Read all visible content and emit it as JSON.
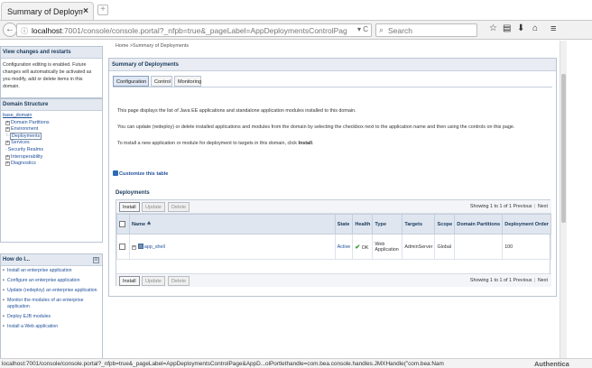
{
  "browser": {
    "tab_title": "Summary of Deploymen...",
    "tab_close": "×",
    "new_tab": "+",
    "url_host": "localhost",
    "url_path": ":7001/console/console.portal?_nfpb=true&_pageLabel=AppDeploymentsControlPage&AppDeploymentsContro",
    "search_placeholder": "Search",
    "nav_icons": [
      "star-icon",
      "bookmarks-icon",
      "download-icon",
      "home-icon",
      "menu-icon"
    ]
  },
  "sidebar": {
    "change_center": {
      "title": "View changes and restarts",
      "body": "Configuration editing is enabled. Future changes will automatically be activated as you modify, add or delete items in this domain."
    },
    "domain_structure": {
      "title": "Domain Structure",
      "root": "base_domain",
      "items": [
        {
          "label": "Domain Partitions",
          "level": 1,
          "expand": "+"
        },
        {
          "label": "Environment",
          "level": 1,
          "expand": "+"
        },
        {
          "label": "Deployments",
          "level": 1,
          "expand": "",
          "selected": true
        },
        {
          "label": "Services",
          "level": 1,
          "expand": "+"
        },
        {
          "label": "Security Realms",
          "level": 1,
          "expand": "-"
        },
        {
          "label": "Interoperability",
          "level": 1,
          "expand": "+"
        },
        {
          "label": "Diagnostics",
          "level": 1,
          "expand": "+"
        }
      ]
    },
    "how_do_i": {
      "title": "How do I...",
      "items": [
        "Install an enterprise application",
        "Configure an enterprise application",
        "Update (redeploy) an enterprise application",
        "Monitor the modules of an enterprise application",
        "Deploy EJB modules",
        "Install a Web application"
      ]
    }
  },
  "main": {
    "breadcrumb": "Home >Summary of Deployments",
    "title": "Summary of Deployments",
    "tabs": [
      "Configuration",
      "Control",
      "Monitoring"
    ],
    "desc1": "This page displays the list of Java EE applications and standalone application modules installed to this domain.",
    "desc2": "You can update (redeploy) or delete installed applications and modules from the domain by selecting the checkbox next to the application name and then using the controls on this page.",
    "desc3_pre": "To install a new application or module for deployment to targets in this domain, click ",
    "desc3_bold": "Install",
    "desc3_post": ".",
    "customize": "Customize this table",
    "deployments_label": "Deployments",
    "buttons": {
      "install": "Install",
      "update": "Update",
      "delete": "Delete"
    },
    "pager": {
      "showing": "Showing 1 to 1 of 1",
      "previous": "Previous",
      "sep": "|",
      "next": "Next"
    },
    "columns": [
      "Name",
      "State",
      "Health",
      "Type",
      "Targets",
      "Scope",
      "Domain Partitions",
      "Deployment Order"
    ],
    "sort_glyph": "≙",
    "rows": [
      {
        "expand": "+",
        "name": "app_shell",
        "state": "Active",
        "health_icon": "✔",
        "health": "OK",
        "type": "Web Application",
        "targets": "AdminServer",
        "scope": "Global",
        "partitions": "",
        "order": "100"
      }
    ]
  },
  "status_bar": {
    "text": "localhost:7001/console/console.portal?_nfpb=true&_pageLabel=AppDeploymentsControlPage&AppD...olPortlethandle=com.bea.console.handles.JMXHandle(\"com.bea:Nam",
    "auth": "Authentica"
  }
}
